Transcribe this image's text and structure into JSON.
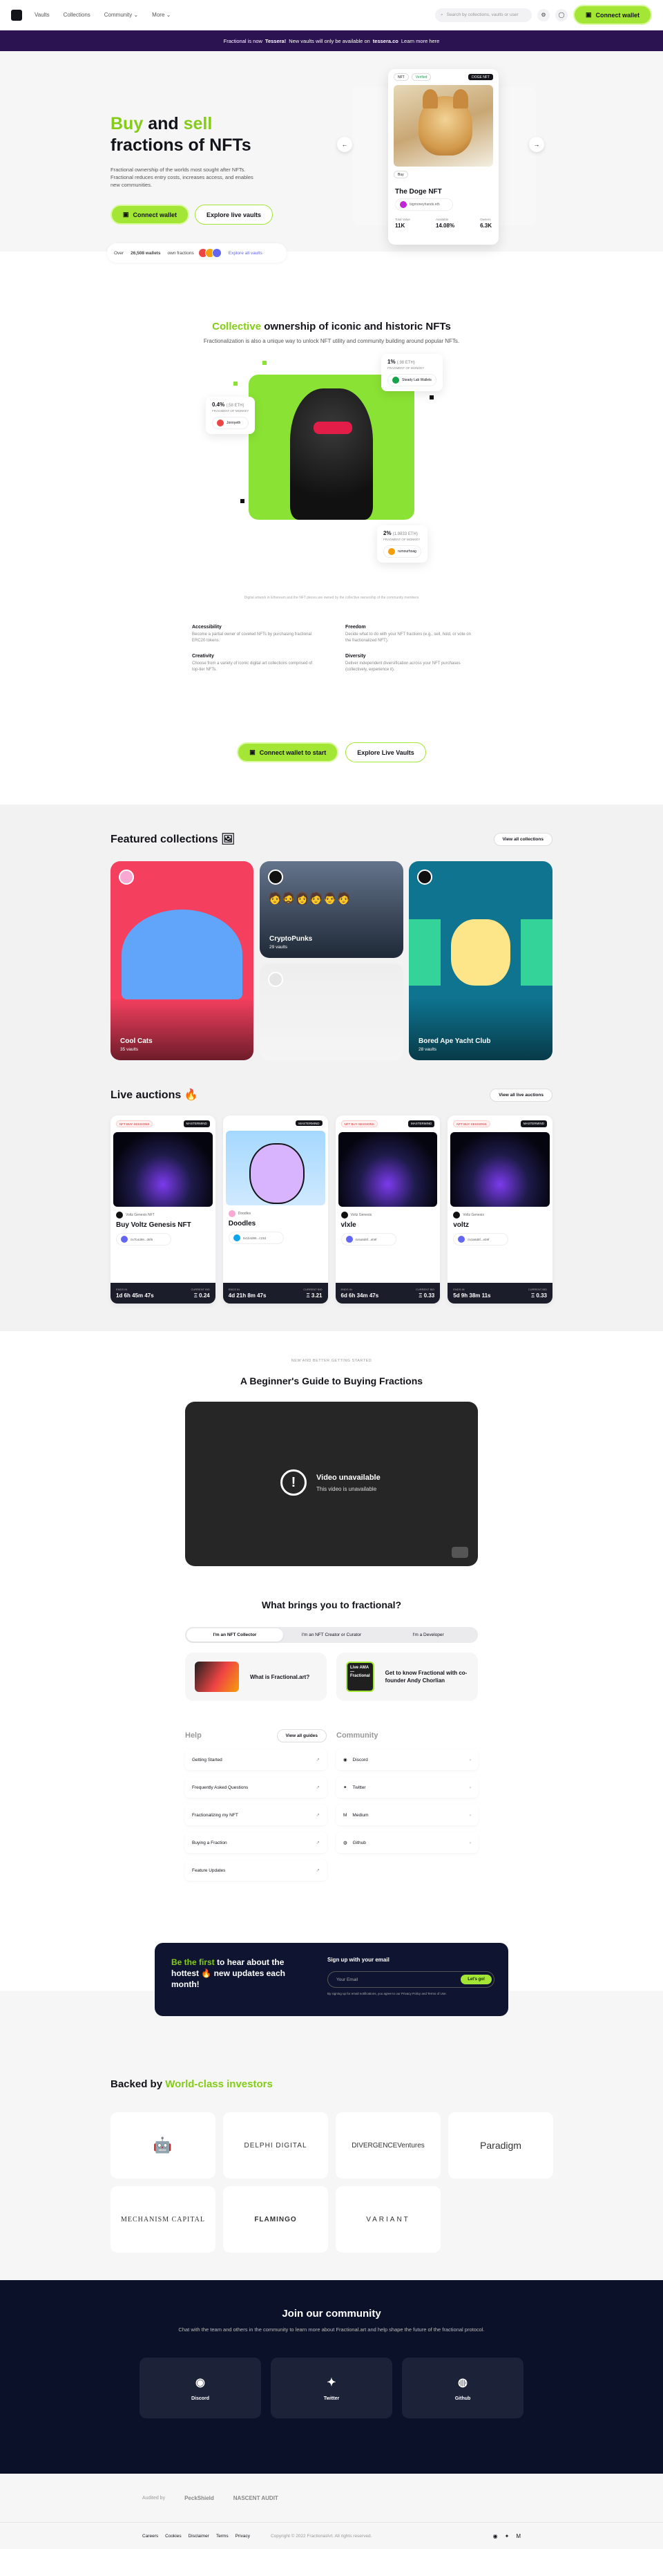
{
  "nav": {
    "links": [
      "Vaults",
      "Collections",
      "Community",
      "More"
    ],
    "search_placeholder": "Search by collections, vaults or user",
    "connect_wallet": "Connect wallet"
  },
  "banner": {
    "text1": "Fractional is now",
    "brand": "Tessera!",
    "text2": "New vaults will only be available on",
    "site": "tessera.co",
    "text3": "Learn more here"
  },
  "hero": {
    "title_w1": "Buy",
    "title_w2": "and",
    "title_w3": "sell",
    "title_w4": "fractions of NFTs",
    "subtitle": "Fractional ownership of the worlds most sought after NFTs. Fractional reduces entry costs, increases access, and enables new communities.",
    "connect_wallet": "Connect wallet",
    "explore": "Explore live vaults",
    "owners_prefix": "Over",
    "owners_count": "26,508 wallets",
    "owners_suffix": "own fractions",
    "explore_all": "Explore all vaults"
  },
  "doge_card": {
    "tag_nft": "NFT",
    "tag_verified": "Verified",
    "tag_doge": "DOGE NFT",
    "tag_buy": "Buy",
    "name": "The Doge NFT",
    "owner": "bigmoneyhands.eth",
    "stats": [
      {
        "k": "Total Value",
        "v": "11K"
      },
      {
        "k": "Available",
        "v": "14.08%"
      },
      {
        "k": "Owners",
        "v": "6.3K"
      }
    ]
  },
  "collective": {
    "title_accent": "Collective",
    "title_rest": "ownership of iconic and historic NFTs",
    "subtitle": "Fractionalization is also a unique way to unlock NFT utility and community building around popular NFTs.",
    "cards": [
      {
        "pct": "1%",
        "eth": "(.98 ETH)",
        "lbl": "FRAGMENT OF MONKEY",
        "who": "Steady Lab Wallets"
      },
      {
        "pct": "0.4%",
        "eth": "(.58 ETH)",
        "lbl": "FRAGMENT OF MONKEY",
        "who": "Jonnyeth"
      },
      {
        "pct": "2%",
        "eth": "(1.9833 ETH)",
        "lbl": "FRAGMENT OF MONKEY",
        "who": "rumourhoag"
      }
    ],
    "caption": "Digital artwork in Ethereum and the NFT pieces are owned by the collective ownership of the community members",
    "features": [
      {
        "h": "Accessibility",
        "p": "Become a partial owner of coveted NFTs by purchasing fractional ERC20 tokens."
      },
      {
        "h": "Freedom",
        "p": "Decide what to do with your NFT fractions (e.g., sell, hold, or vote on the fractionalized NFT)."
      },
      {
        "h": "Creativity",
        "p": "Choose from a variety of iconic digital art collections comprised of top-tier NFTs."
      },
      {
        "h": "Diversity",
        "p": "Deliver independent diversification across your NFT purchases (collectively, experience it)."
      }
    ],
    "connect_wallet": "Connect wallet to start",
    "explore": "Explore Live Vaults"
  },
  "collections": {
    "title": "Featured collections",
    "view_all": "View all collections",
    "items": [
      {
        "name": "Cool Cats",
        "vaults": "35 vaults"
      },
      {
        "name": "CryptoPunks",
        "vaults": "29 vaults"
      },
      {
        "name": "Bored Ape Yacht Club",
        "vaults": "28 vaults"
      }
    ]
  },
  "auctions": {
    "title": "Live auctions",
    "view_all": "View all live auctions",
    "items": [
      {
        "tag": "NFT BUY SESSIONS",
        "badge": "MASTERMIND",
        "coll": "Voltz Genesis NFT",
        "name": "Buy Voltz Genesis NFT",
        "owner": "0x7b4d99...d6f6",
        "ends_k": "ENDS IN",
        "ends": "1d 6h 45m 47s",
        "bid_k": "CURRENT BID",
        "bid": "Ξ 0.24"
      },
      {
        "tag": "",
        "badge": "MASTERMIND",
        "coll": "Doodles",
        "name": "Doodles",
        "owner": "0x1b4d86...c23d",
        "ends_k": "ENDS IN",
        "ends": "4d 21h 8m 47s",
        "bid_k": "CURRENT BID",
        "bid": "Ξ 3.21"
      },
      {
        "tag": "NFT BUY SESSIONS",
        "badge": "MASTERMIND",
        "coll": "Voltz Genesis",
        "name": "vlxle",
        "owner": "0x5a9d8f...eb9f",
        "ends_k": "ENDS IN",
        "ends": "6d 6h 34m 47s",
        "bid_k": "CURRENT BID",
        "bid": "Ξ 0.33"
      },
      {
        "tag": "NFT BUY SESSIONS",
        "badge": "MASTERMIND",
        "coll": "Voltz Genesis",
        "name": "voltz",
        "owner": "0x3a9d8f...eb9f",
        "ends_k": "ENDS IN",
        "ends": "5d 9h 38m 11s",
        "bid_k": "CURRENT BID",
        "bid": "Ξ 0.33"
      }
    ]
  },
  "guide": {
    "kicker": "NEW AND BETTER GETTING STARTED",
    "title": "A Beginner's Guide to Buying Fractions",
    "video_title": "Video unavailable",
    "video_sub": "This video is unavailable"
  },
  "brings": {
    "title": "What brings you to fractional?",
    "tabs": [
      "I'm an NFT Collector",
      "I'm an NFT Creator or Curator",
      "I'm a Developer"
    ],
    "cards": [
      "What is Fractional.art?",
      "Get to know Fractional with co-founder Andy Chorlian"
    ],
    "ama": "Live AMA — Fractional"
  },
  "help": {
    "title": "Help",
    "all_guides": "View all guides",
    "items": [
      "Getting Started",
      "Frequently Asked Questions",
      "Fractionalizing my NFT",
      "Buying a Fraction",
      "Feature Updates"
    ]
  },
  "community_links": {
    "title": "Community",
    "items": [
      "Discord",
      "Twitter",
      "Medium",
      "Github"
    ]
  },
  "newsletter": {
    "accent": "Be the first",
    "rest": "to hear about the hottest 🔥 new updates each month!",
    "heading": "Sign up with your email",
    "placeholder": "Your Email",
    "submit": "Let's go!",
    "fine": "By signing up for email notifications, you agree to our Privacy Policy and Terms of Use."
  },
  "investors": {
    "title_a": "Backed by",
    "title_b": "World-class investors",
    "items": [
      "",
      "DELPHI DIGITAL",
      "DIVERGENCEVentures",
      "Paradigm",
      "MECHANISM CAPITAL",
      "FLAMINGO",
      "VARIANT"
    ]
  },
  "community": {
    "title": "Join our community",
    "subtitle": "Chat with the team and others in the community to learn more about Fractional.art and help shape the future of the fractional protocol.",
    "items": [
      "Discord",
      "Twitter",
      "Github"
    ]
  },
  "audit": {
    "label": "Audited by",
    "a1": "PeckShield",
    "a2": "NASCENT AUDIT"
  },
  "footer": {
    "links": [
      "Careers",
      "Cookies",
      "Disclaimer",
      "Terms",
      "Privacy"
    ],
    "copy": "Copyright © 2022 FractionalArt. All rights reserved."
  },
  "colors": {
    "accent": "#a3e635",
    "dark": "#0b1128",
    "banner": "#2b1251"
  }
}
